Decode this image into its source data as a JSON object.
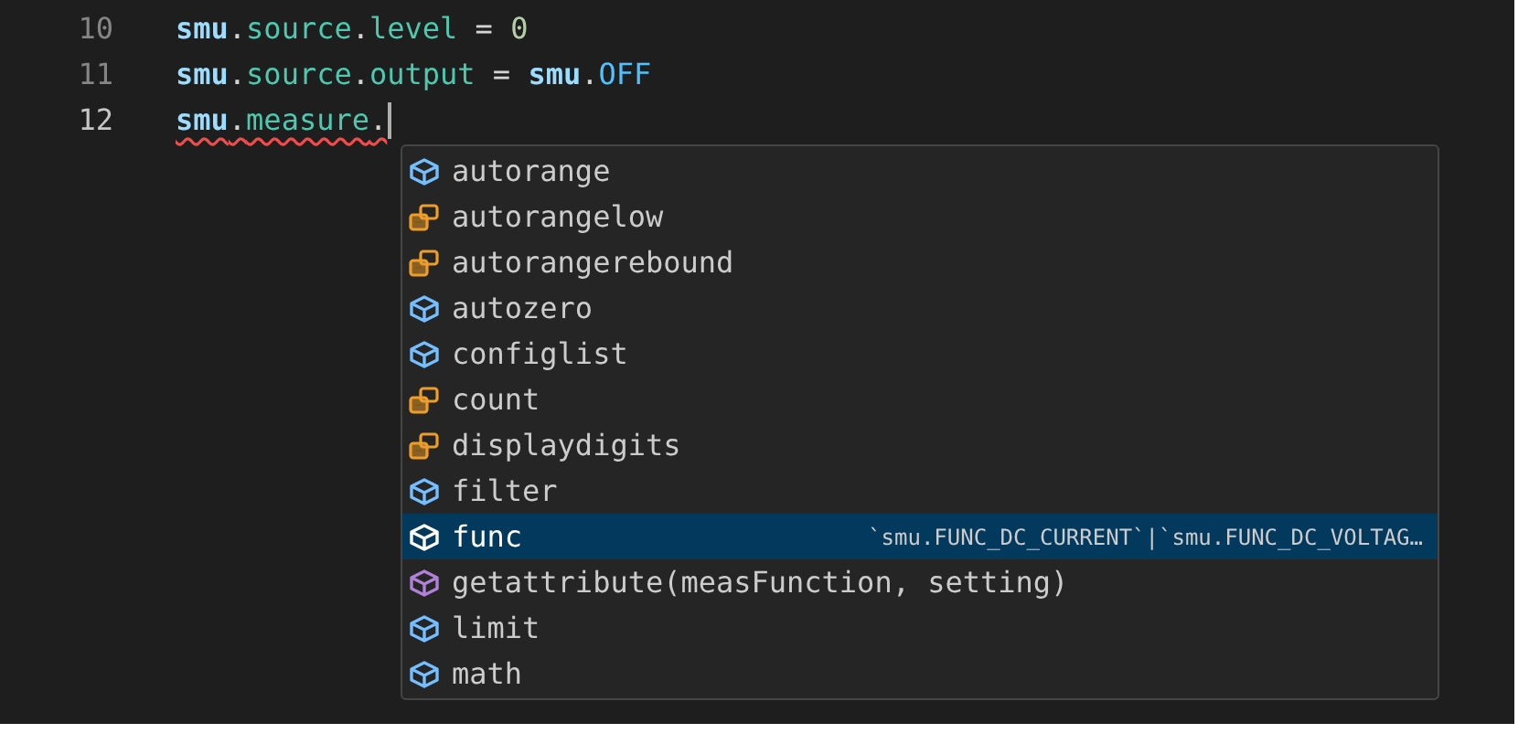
{
  "editor": {
    "lines": [
      {
        "number": "10",
        "current": false,
        "squiggle": false,
        "tokens": [
          {
            "text": "smu",
            "kind": "variable"
          },
          {
            "text": ".",
            "kind": "plain"
          },
          {
            "text": "source",
            "kind": "property"
          },
          {
            "text": ".",
            "kind": "plain"
          },
          {
            "text": "level",
            "kind": "property"
          },
          {
            "text": " = ",
            "kind": "plain"
          },
          {
            "text": "0",
            "kind": "number"
          }
        ]
      },
      {
        "number": "11",
        "current": false,
        "squiggle": false,
        "tokens": [
          {
            "text": "smu",
            "kind": "variable"
          },
          {
            "text": ".",
            "kind": "plain"
          },
          {
            "text": "source",
            "kind": "property"
          },
          {
            "text": ".",
            "kind": "plain"
          },
          {
            "text": "output",
            "kind": "property"
          },
          {
            "text": " = ",
            "kind": "plain"
          },
          {
            "text": "smu",
            "kind": "variable"
          },
          {
            "text": ".",
            "kind": "plain"
          },
          {
            "text": "OFF",
            "kind": "constant"
          }
        ]
      },
      {
        "number": "12",
        "current": true,
        "squiggle": true,
        "tokens": [
          {
            "text": "smu",
            "kind": "variable"
          },
          {
            "text": ".",
            "kind": "plain"
          },
          {
            "text": "measure",
            "kind": "property"
          },
          {
            "text": ".",
            "kind": "plain"
          }
        ]
      }
    ]
  },
  "suggestions": [
    {
      "label": "autorange",
      "kind": "module",
      "selected": false
    },
    {
      "label": "autorangelow",
      "kind": "enum",
      "selected": false
    },
    {
      "label": "autorangerebound",
      "kind": "enum",
      "selected": false
    },
    {
      "label": "autozero",
      "kind": "module",
      "selected": false
    },
    {
      "label": "configlist",
      "kind": "module",
      "selected": false
    },
    {
      "label": "count",
      "kind": "enum",
      "selected": false
    },
    {
      "label": "displaydigits",
      "kind": "enum",
      "selected": false
    },
    {
      "label": "filter",
      "kind": "module",
      "selected": false
    },
    {
      "label": "func",
      "kind": "module",
      "selected": true,
      "detail": "`smu.FUNC_DC_CURRENT`|`smu.FUNC_DC_VOLTAG…"
    },
    {
      "label": "getattribute(measFunction, setting)",
      "kind": "method",
      "selected": false
    },
    {
      "label": "limit",
      "kind": "module",
      "selected": false
    },
    {
      "label": "math",
      "kind": "module",
      "selected": false
    }
  ]
}
